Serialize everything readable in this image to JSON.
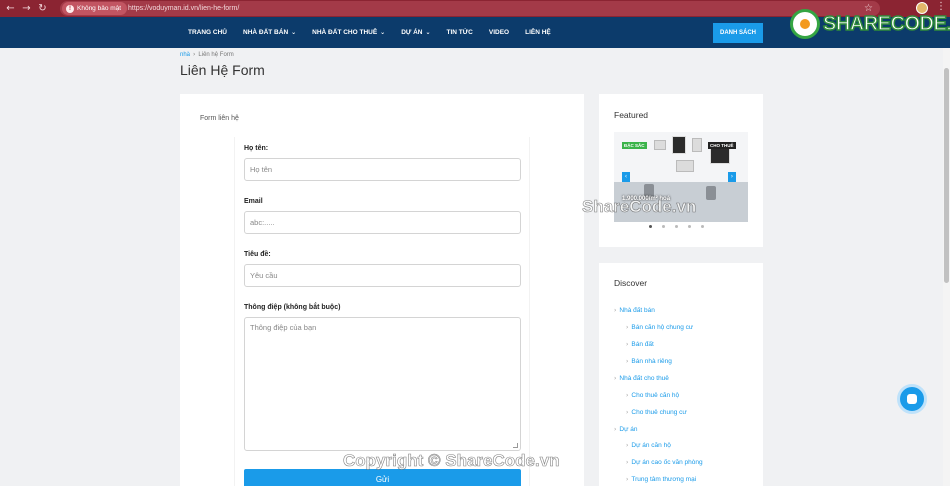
{
  "browser": {
    "secure_label": "Không bảo mật",
    "url": "https://voduyman.id.vn/lien-he-form/"
  },
  "nav": {
    "items": [
      {
        "label": "TRANG CHỦ",
        "dropdown": false
      },
      {
        "label": "NHÀ ĐẤT BÁN",
        "dropdown": true
      },
      {
        "label": "NHÀ ĐẤT CHO THUÊ",
        "dropdown": true
      },
      {
        "label": "DỰ ÁN",
        "dropdown": true
      },
      {
        "label": "TIN TỨC",
        "dropdown": false
      },
      {
        "label": "VIDEO",
        "dropdown": false
      },
      {
        "label": "LIÊN HỆ",
        "dropdown": false
      }
    ],
    "cta_label": "DANH SÁCH"
  },
  "logo": {
    "text": "SHARECODE.vn"
  },
  "breadcrumb": {
    "home": "nhà",
    "current": "Liên hệ Form"
  },
  "page_title": "Liên Hệ Form",
  "form": {
    "intro": "Form liên hệ",
    "name_label": "Họ tên:",
    "name_placeholder": "Họ tên",
    "email_label": "Email",
    "email_placeholder": "abc:.....",
    "subject_label": "Tiêu đề:",
    "subject_placeholder": "Yêu cầu",
    "message_label": "Thông điệp (không bắt buộc)",
    "message_placeholder": "Thông điệp của bạn",
    "submit_label": "Gửi"
  },
  "featured": {
    "title": "Featured",
    "slide_price": "1.900.000/m²",
    "slide_caption": "hoá",
    "badge_left": "ĐẶC SẮC",
    "badge_right": "CHO THUÊ"
  },
  "discover": {
    "title": "Discover",
    "items": [
      {
        "label": "Nhà đất bán",
        "level": 0
      },
      {
        "label": "Bán căn hộ chung cư",
        "level": 1
      },
      {
        "label": "Bán đất",
        "level": 1
      },
      {
        "label": "Bán nhà riêng",
        "level": 1
      },
      {
        "label": "Nhà đất cho thuê",
        "level": 0
      },
      {
        "label": "Cho thuê căn hộ",
        "level": 1
      },
      {
        "label": "Cho thuê chung cư",
        "level": 1
      },
      {
        "label": "Dự án",
        "level": 0
      },
      {
        "label": "Dự án căn hộ",
        "level": 1
      },
      {
        "label": "Dự án cao ốc văn phòng",
        "level": 1
      },
      {
        "label": "Trung tâm thương mại",
        "level": 1
      }
    ]
  },
  "watermarks": {
    "center": "ShareCode.vn",
    "bottom": "Copyright © ShareCode.vn"
  },
  "colors": {
    "nav_bg": "#0c3b6b",
    "accent": "#1a9be9",
    "browser_bar": "#8b2432"
  }
}
